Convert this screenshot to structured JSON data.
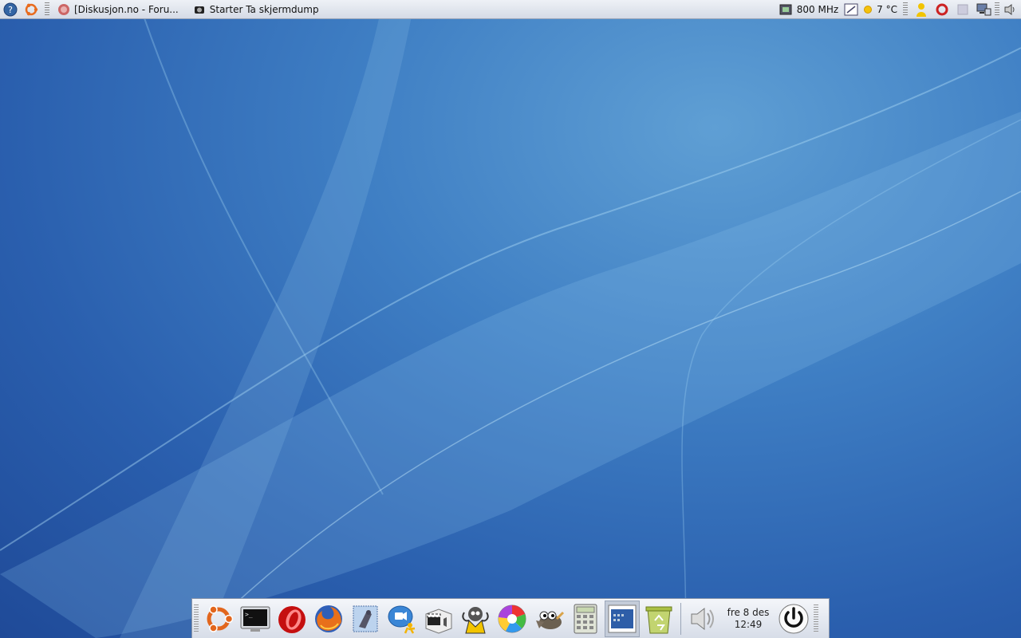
{
  "top_panel": {
    "tasks": [
      {
        "label": "[Diskusjon.no - Foru...",
        "icon": "firefox-icon"
      },
      {
        "label": "Starter Ta skjermdump",
        "icon": "camera-icon"
      }
    ],
    "cpu_freq": "800 MHz",
    "weather_temp": "7 °C"
  },
  "dock": {
    "launchers": [
      "ubuntu-logo",
      "terminal",
      "opera",
      "firefox",
      "evolution-mail",
      "ekiga",
      "aim-messenger",
      "totem-video",
      "gaim",
      "picasa",
      "gimp",
      "calculator",
      "system-monitor",
      "trash"
    ],
    "clock_day": "fre  8 des",
    "clock_time": "12:49"
  },
  "colors": {
    "desktop": "#2f68b4",
    "panel": "#dfe4ec"
  }
}
